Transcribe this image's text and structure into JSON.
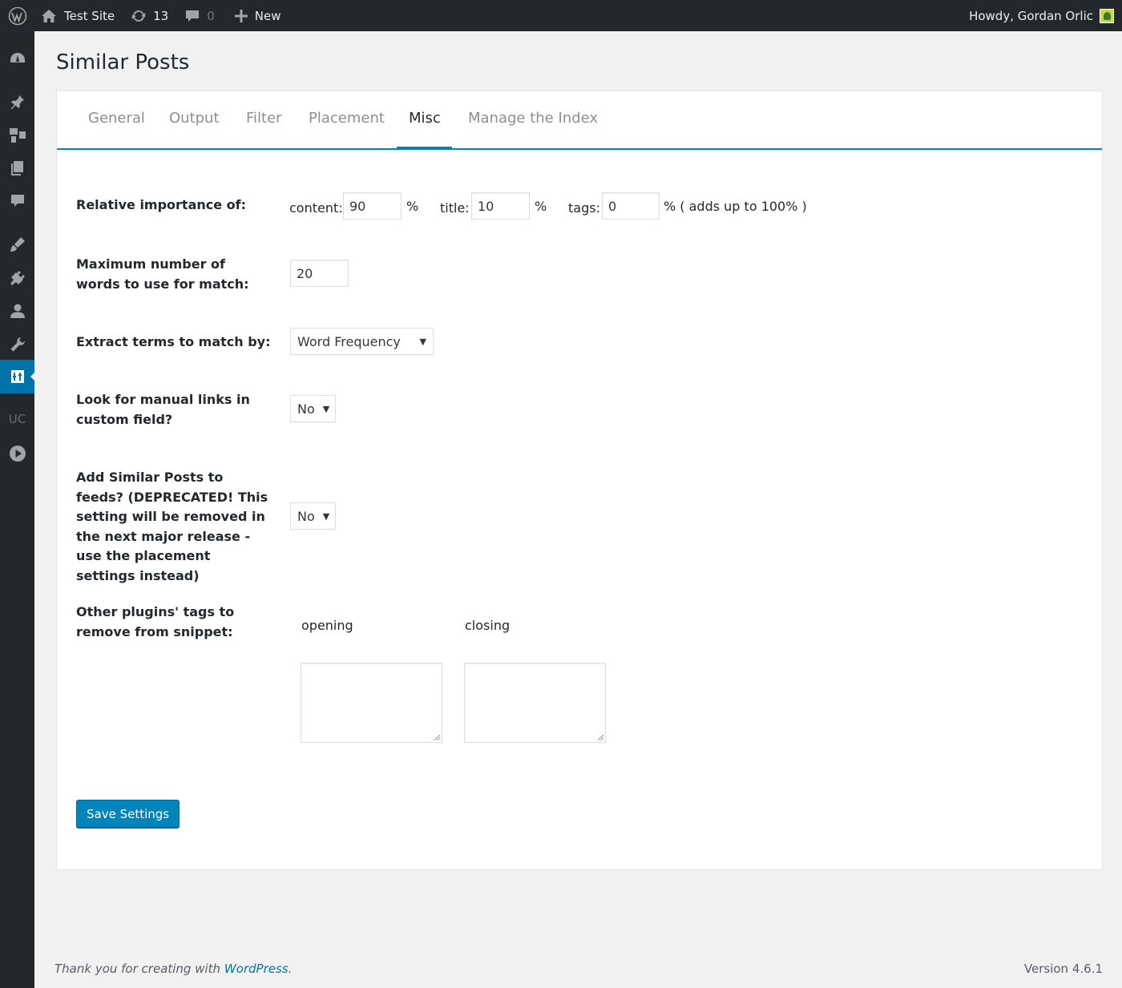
{
  "adminbar": {
    "site_name": "Test Site",
    "updates_count": "13",
    "comments_count": "0",
    "new_label": "New",
    "howdy": "Howdy, Gordan Orlic"
  },
  "page": {
    "title": "Similar Posts"
  },
  "tabs": [
    {
      "label": "General"
    },
    {
      "label": "Output"
    },
    {
      "label": "Filter"
    },
    {
      "label": "Placement"
    },
    {
      "label": "Misc",
      "active": true
    },
    {
      "label": "Manage the Index"
    }
  ],
  "settings": {
    "relative_importance": {
      "label": "Relative importance of:",
      "content_label": "content:",
      "content_value": "90",
      "title_label": "title:",
      "title_value": "10",
      "tags_label": "tags:",
      "tags_value": "0",
      "percent": "%",
      "adds_up": "% ( adds up to 100% )"
    },
    "max_words": {
      "label": "Maximum number of words to use for match:",
      "value": "20"
    },
    "extract_terms": {
      "label": "Extract terms to match by:",
      "selected": "Word Frequency"
    },
    "manual_links": {
      "label": "Look for manual links in custom field?",
      "selected": "No"
    },
    "feeds": {
      "label": "Add Similar Posts to feeds? (DEPRECATED! This setting will be removed in the next major release - use the placement settings instead)",
      "selected": "No"
    },
    "remove_tags": {
      "label": "Other plugins' tags to remove from snippet:",
      "opening_label": "opening",
      "closing_label": "closing",
      "opening_value": "",
      "closing_value": ""
    }
  },
  "save_button": "Save Settings",
  "footer": {
    "thanks_prefix": "Thank you for creating with ",
    "wordpress_link": "WordPress",
    "thanks_suffix": ".",
    "version": "Version 4.6.1"
  },
  "colors": {
    "adminbar_bg": "#23282d",
    "accent": "#0085ba",
    "background": "#f1f1f1"
  }
}
